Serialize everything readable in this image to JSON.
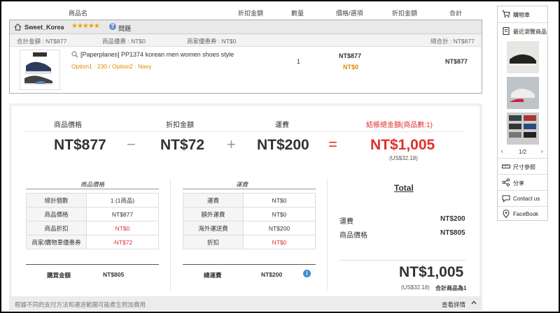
{
  "table_header": {
    "product": "商品名",
    "discount": "折扣金額",
    "qty": "數量",
    "price_option": "價格/選項",
    "discount2": "折扣金額",
    "total": "合計"
  },
  "seller": {
    "name": "Sweet_Korea",
    "stars": "★★★★★",
    "question": "問題"
  },
  "summary": {
    "subtotal": "合計金額 : NT$877",
    "product_discount": "商品優惠 : NT$0",
    "shop_coupon": "商家優惠券 : NT$0",
    "grand": "總合計 : NT$877"
  },
  "item": {
    "name": "[Paperplanes] PP1374 korean men women shoes style",
    "option": "Option1 : 230 / Option2 : Navy",
    "qty": "1",
    "price": "NT$877",
    "price_discount": "NT$0",
    "total": "NT$877"
  },
  "calc": {
    "label_price": "商品價格",
    "label_discount": "折扣金額",
    "label_shipping": "運費",
    "label_total": "結帳總金額(商品數:1)",
    "price": "NT$877",
    "minus": "−",
    "discount": "NT$72",
    "plus": "+",
    "shipping": "NT$200",
    "equals": "=",
    "total": "NT$1,005",
    "usd": "(US$32.18)"
  },
  "product_table": {
    "title": "商品價格",
    "rows": [
      {
        "k": "總計個數",
        "v": "1 (1商品)"
      },
      {
        "k": "商品價格",
        "v": "NT$877"
      },
      {
        "k": "商品折扣",
        "v": "NT$0"
      },
      {
        "k": "商家/購物車優惠券",
        "v": "-NT$72"
      }
    ],
    "footer_k": "購買金額",
    "footer_v": "NT$805"
  },
  "shipping_table": {
    "title": "運費",
    "rows": [
      {
        "k": "運費",
        "v": "NT$0"
      },
      {
        "k": "額外運費",
        "v": "NT$0"
      },
      {
        "k": "海外運送費",
        "v": "NT$200"
      },
      {
        "k": "折扣",
        "v": "NT$0"
      }
    ],
    "footer_k": "總運費",
    "footer_v": "NT$200"
  },
  "total_box": {
    "title": "Total",
    "shipping_label": "運費",
    "shipping_value": "NT$200",
    "price_label": "商品價格",
    "price_value": "NT$805",
    "grand": "NT$1,005",
    "usd": "(US$32.18)",
    "count": "合計商品為1"
  },
  "footer": {
    "note": "根據不同的支付方法和運送範圍可能產生附加費用",
    "details": "查看詳情"
  },
  "sidebar": {
    "cart": "購物車",
    "recent": "最近瀏覽商品",
    "pager": "1/2",
    "size": "尺寸參照",
    "share": "分享",
    "contact": "Contact us",
    "facebook": "FaceBook"
  }
}
